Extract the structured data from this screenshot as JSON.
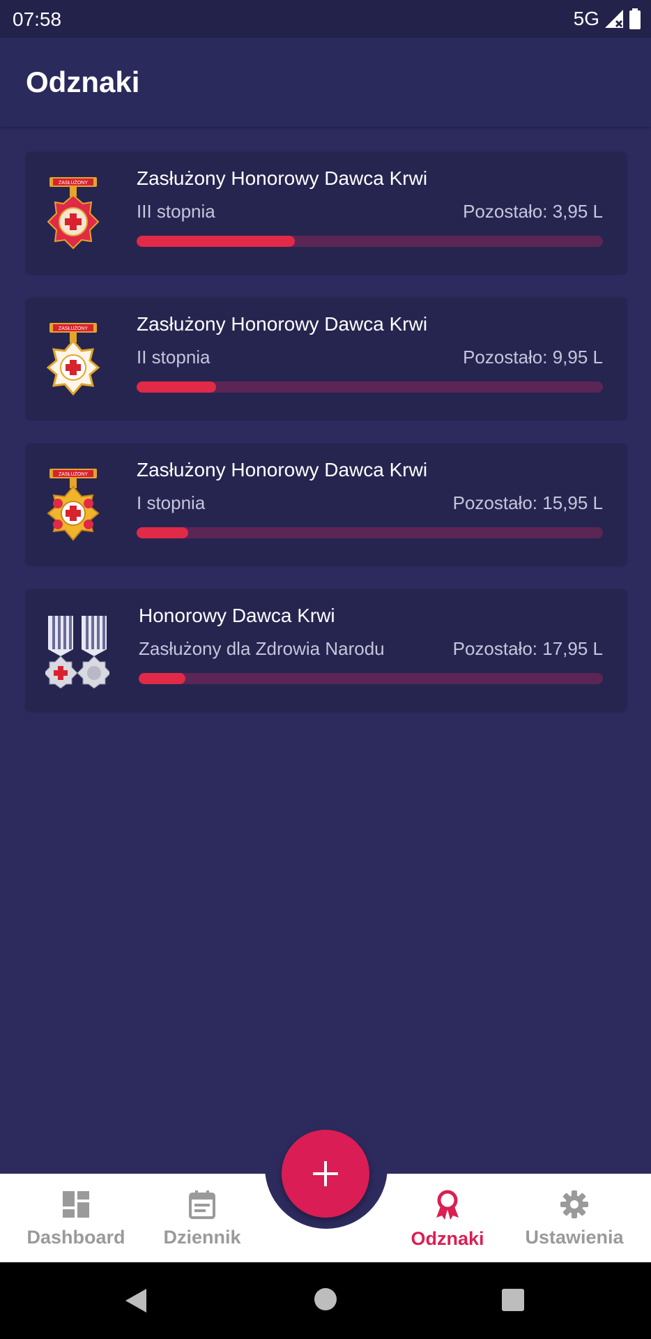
{
  "status_bar": {
    "time": "07:58",
    "network": "5G"
  },
  "app_bar": {
    "title": "Odznaki"
  },
  "badges": [
    {
      "title": "Zasłużony Honorowy Dawca Krwi",
      "subtitle": "III stopnia",
      "remaining": "Pozostało: 3,95 L",
      "progress": 0.34
    },
    {
      "title": "Zasłużony Honorowy Dawca Krwi",
      "subtitle": "II stopnia",
      "remaining": "Pozostało: 9,95 L",
      "progress": 0.17
    },
    {
      "title": "Zasłużony Honorowy Dawca Krwi",
      "subtitle": "I stopnia",
      "remaining": "Pozostało: 15,95 L",
      "progress": 0.11
    },
    {
      "title": "Honorowy Dawca Krwi",
      "subtitle": "Zasłużony dla Zdrowia Narodu",
      "remaining": "Pozostało: 17,95 L",
      "progress": 0.1
    }
  ],
  "medal_ribbon_text": "ZASŁUŻONY",
  "bottom_nav": {
    "items": [
      {
        "label": "Dashboard",
        "icon": "dashboard-icon",
        "active": false
      },
      {
        "label": "Dziennik",
        "icon": "calendar-icon",
        "active": false
      },
      {
        "label": "Odznaki",
        "icon": "award-icon",
        "active": true
      },
      {
        "label": "Ustawienia",
        "icon": "gear-icon",
        "active": false
      }
    ],
    "fab_icon": "plus-icon"
  },
  "colors": {
    "background": "#2d2b5e",
    "card": "#262550",
    "accent": "#e02a47",
    "track": "#5b2655",
    "nav_active": "#db1f52",
    "nav_inactive": "#9a9a9a"
  }
}
